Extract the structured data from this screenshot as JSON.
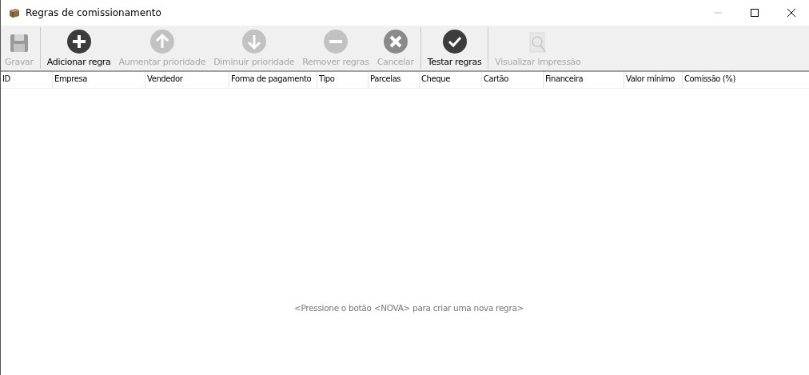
{
  "window": {
    "title": "Regras de comissionamento"
  },
  "toolbar": [
    {
      "kind": "save",
      "label": "Gravar",
      "disabled": true
    },
    {
      "kind": "separator"
    },
    {
      "kind": "add",
      "label": "Adicionar regra",
      "disabled": false
    },
    {
      "kind": "up",
      "label": "Aumentar prioridade",
      "disabled": true
    },
    {
      "kind": "down",
      "label": "Diminuir prioridade",
      "disabled": true
    },
    {
      "kind": "remove",
      "label": "Remover regras",
      "disabled": true
    },
    {
      "kind": "cancel",
      "label": "Cancelar",
      "disabled": true
    },
    {
      "kind": "separator"
    },
    {
      "kind": "test",
      "label": "Testar regras",
      "disabled": false
    },
    {
      "kind": "separator"
    },
    {
      "kind": "preview",
      "label": "Visualizar impressão",
      "disabled": true
    }
  ],
  "table": {
    "columns": [
      "ID",
      "Empresa",
      "Vendedor",
      "Forma de pagamento",
      "Tipo",
      "Parcelas",
      "Cheque",
      "Cartão",
      "Financeira",
      "Valor mínimo",
      "Comissão (%)"
    ],
    "empty_message": "<Pressione o botão <NOVA> para criar uma nova regra>"
  }
}
